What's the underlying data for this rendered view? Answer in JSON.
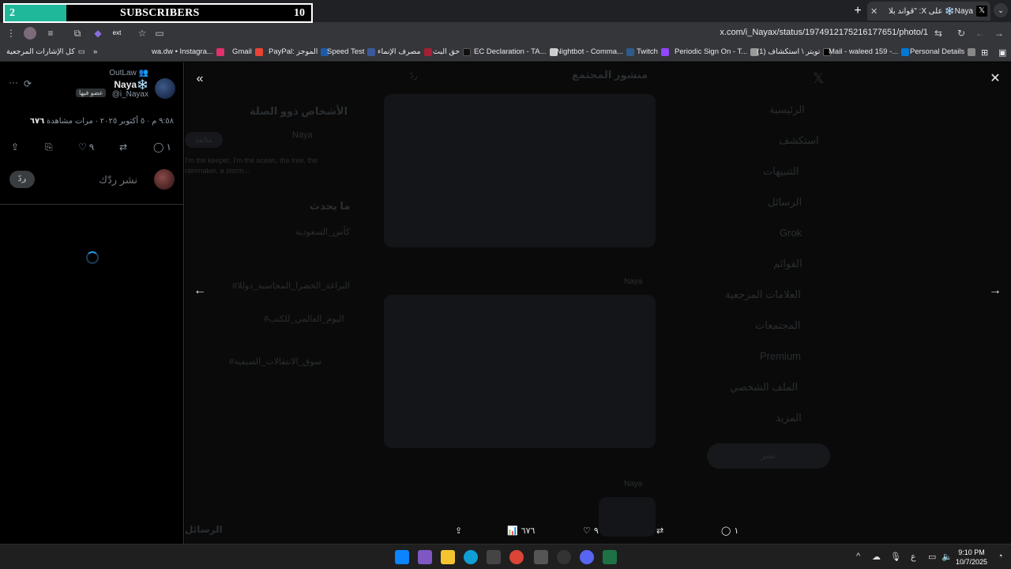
{
  "overlay": {
    "current": "2",
    "label": "SUBSCRIBERS",
    "goal": "10",
    "progress": 0.2
  },
  "tab": {
    "title": "Naya❄️ على X: \"قواند بلا نقاش\"",
    "new_tab": "+",
    "close": "✕"
  },
  "address": {
    "url": "x.com/i_Nayax/status/1974912175216177651/photo/1"
  },
  "bookmarks": {
    "all_bookmarks": "كل الإشارات المرجعية",
    "overflow": "»",
    "items": [
      {
        "label": "wa.dw • Instagra...",
        "color": "#e1306c"
      },
      {
        "label": "Gmail",
        "color": "#ea4335"
      },
      {
        "label": "PayPal: الموجز",
        "color": "#1e5aa8"
      },
      {
        "label": "Speed Test",
        "color": "#3b5998"
      },
      {
        "label": "مصرف الإنماء",
        "color": "#a31f34"
      },
      {
        "label": "حق البث",
        "color": "#111111"
      },
      {
        "label": "EC Declaration - TA...",
        "color": "#cccccc"
      },
      {
        "label": "Nightbot - Comma...",
        "color": "#2f5a8c"
      },
      {
        "label": "Twitch",
        "color": "#9146ff"
      },
      {
        "label": "Periodic Sign On - T...",
        "color": "#999999"
      },
      {
        "label": "(1) تويتر \\ استكشاف",
        "color": "#000000"
      },
      {
        "label": "Mail - waleed 159 -...",
        "color": "#0078d4"
      },
      {
        "label": "Personal Details",
        "color": "#888888"
      }
    ]
  },
  "tweet": {
    "community": "OutLaw",
    "display_name": "Naya❄️",
    "handle": "@i_Nayax",
    "member_badge": "عضو فيها",
    "more": "···",
    "meta_time": "٩:٥٨ م · ٥ أكتوبر ٢٠٢٥ ·",
    "views_count": "٦٧٦",
    "views_label": "مرات مشاهدة",
    "likes": "٩",
    "replies": "١",
    "reply_placeholder": "نشر ردّك",
    "reply_button": "ردّ"
  },
  "background_ghost": {
    "search_placeholder": "ردّ",
    "header": "منشور المجتمع",
    "who_to_follow": "الأشخاص ذوو الصلة",
    "follow": "متابعة",
    "ghost_name": "Naya",
    "bio": "I'm the keeper, I'm the ocean, the tree, the rainmaker, a storm...",
    "whats_happening": "ما يحدث",
    "trends": [
      "كأس_السعودية",
      "#البراغة_الخضرا_المحاسبة_دوللا",
      "#اليوم_العالمي_للكتب",
      "#سوق_الانتقالات_الصيفية"
    ],
    "nav": [
      "الرئيسية",
      "استكشف",
      "التنبيهات",
      "الرسائل",
      "Grok",
      "القوائم",
      "العلامات المرجعية",
      "المجتمعات",
      "Premium",
      "الملف الشخصي",
      "المزيد"
    ],
    "post_button": "نشر",
    "messages": "الرسائل",
    "feed_name": "Naya"
  },
  "media_bar": {
    "views": "٦٧٦",
    "likes": "٩",
    "replies": "١"
  },
  "taskbar": {
    "lang": "ع",
    "time": "9:10 PM",
    "date": "10/7/2025"
  }
}
